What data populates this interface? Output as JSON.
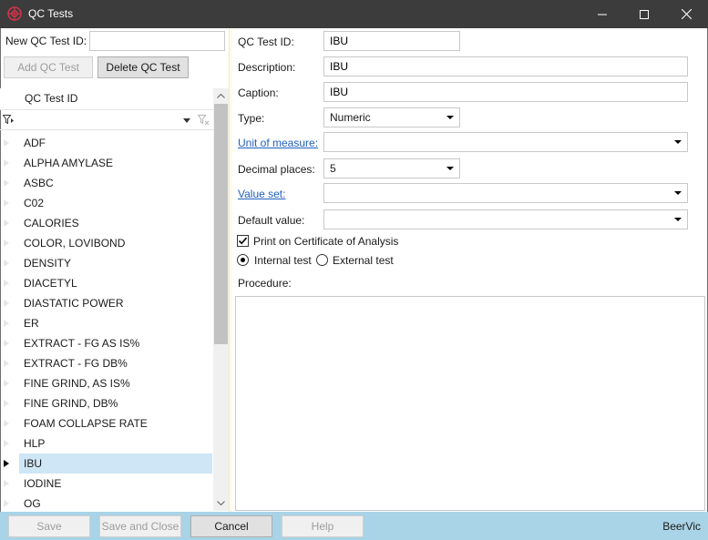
{
  "window": {
    "title": "QC Tests",
    "icon": "beervic-logo-icon",
    "colors": {
      "titlebar": "#3c3c3c",
      "footer": "#a9d3e6",
      "selection": "#cfe6f6",
      "link": "#1f5fbf"
    }
  },
  "left": {
    "new_id_label": "New QC Test ID:",
    "new_id_value": "",
    "add_label": "Add QC Test",
    "delete_label": "Delete QC Test",
    "grid": {
      "column_header": "QC Test ID",
      "filter_value": "",
      "rows": [
        "ADF",
        "ALPHA AMYLASE",
        "ASBC",
        "C02",
        "CALORIES",
        "COLOR, LOVIBOND",
        "DENSITY",
        "DIACETYL",
        "DIASTATIC POWER",
        "ER",
        "EXTRACT - FG AS IS%",
        "EXTRACT - FG DB%",
        "FINE GRIND, AS IS%",
        "FINE GRIND, DB%",
        "FOAM COLLAPSE RATE",
        "HLP",
        "IBU",
        "IODINE",
        "OG"
      ],
      "selected_row": "IBU"
    }
  },
  "form": {
    "qc_test_id_label": "QC Test ID:",
    "qc_test_id_value": "IBU",
    "description_label": "Description:",
    "description_value": "IBU",
    "caption_label": "Caption:",
    "caption_value": "IBU",
    "type_label": "Type:",
    "type_value": "Numeric",
    "unit_label": "Unit of measure:",
    "unit_value": "",
    "decimal_label": "Decimal places:",
    "decimal_value": "5",
    "value_set_label": "Value set:",
    "value_set_value": "",
    "default_label": "Default value:",
    "default_value": "",
    "print_cert_label": "Print on Certificate of Analysis",
    "print_cert_checked": true,
    "internal_label": "Internal test",
    "external_label": "External test",
    "test_kind": "Internal test",
    "procedure_label": "Procedure:",
    "procedure_value": ""
  },
  "footer": {
    "save_label": "Save",
    "save_close_label": "Save and Close",
    "cancel_label": "Cancel",
    "help_label": "Help",
    "brand": "BeerVic"
  }
}
